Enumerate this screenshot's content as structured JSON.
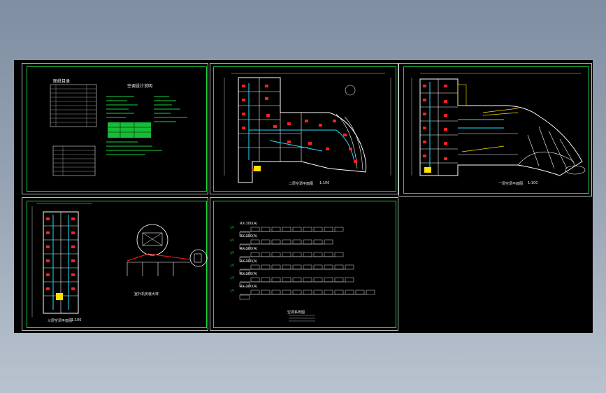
{
  "sheets": [
    {
      "id": "sheet-1",
      "title": "图纸目录",
      "subtitle": "空调设计说明"
    },
    {
      "id": "sheet-2",
      "title": "二层空调平面图",
      "scale": "1:100"
    },
    {
      "id": "sheet-3",
      "title": "一层空调平面图",
      "scale": "1:100"
    },
    {
      "id": "sheet-4",
      "title": "三层空调平面图",
      "scale": "1:100",
      "detail": "室外机安装大样"
    },
    {
      "id": "sheet-5",
      "title": "空调系统图",
      "rows": [
        "5/F",
        "4/F",
        "3/F",
        "2/F",
        "1/F",
        "1/F"
      ],
      "unit": "RX-300(A)"
    }
  ],
  "colors": {
    "background": "#000000",
    "frame": "#19d23c",
    "wall": "#ffffff",
    "duct": "#ff2020",
    "pipe": "#20e0ff",
    "accent": "#ffe000"
  }
}
